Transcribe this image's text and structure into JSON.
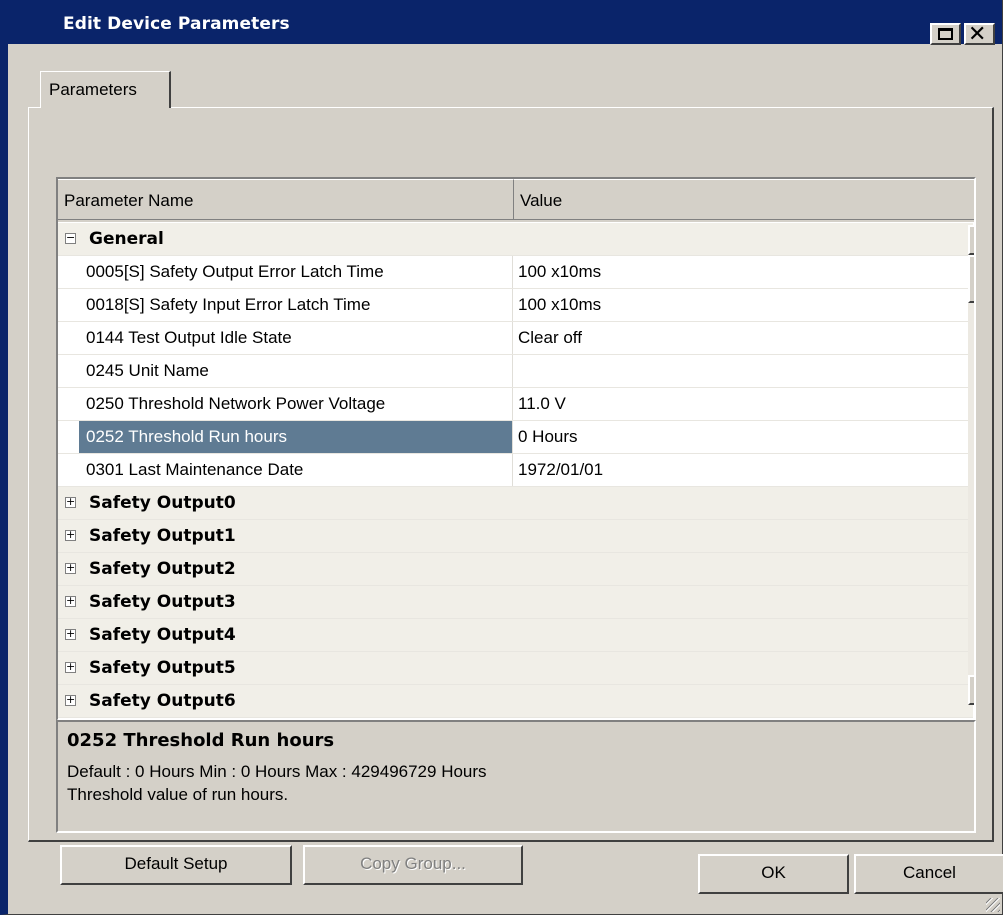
{
  "window": {
    "title": "Edit Device Parameters"
  },
  "tab": {
    "label": "Parameters"
  },
  "grid": {
    "columns": [
      "Parameter Name",
      "Value"
    ],
    "general_group": "General",
    "params": [
      {
        "name": "0005[S] Safety Output Error Latch Time",
        "value": "100 x10ms"
      },
      {
        "name": "0018[S] Safety Input Error Latch Time",
        "value": "100 x10ms"
      },
      {
        "name": "0144 Test Output Idle State",
        "value": "Clear off"
      },
      {
        "name": "0245 Unit Name",
        "value": ""
      },
      {
        "name": "0250 Threshold Network Power Voltage",
        "value": "11.0 V"
      },
      {
        "name": "0252 Threshold Run hours",
        "value": "0 Hours"
      },
      {
        "name": "0301 Last Maintenance Date",
        "value": "1972/01/01"
      }
    ],
    "groups": [
      "Safety Output0",
      "Safety Output1",
      "Safety Output2",
      "Safety Output3",
      "Safety Output4",
      "Safety Output5",
      "Safety Output6"
    ]
  },
  "description": {
    "title": "0252 Threshold Run hours",
    "line1": "Default : 0 Hours  Min : 0 Hours  Max : 429496729 Hours",
    "line2": "Threshold value of run hours."
  },
  "buttons": {
    "default_setup": "Default Setup",
    "copy_group": "Copy Group...",
    "ok": "OK",
    "cancel": "Cancel"
  }
}
